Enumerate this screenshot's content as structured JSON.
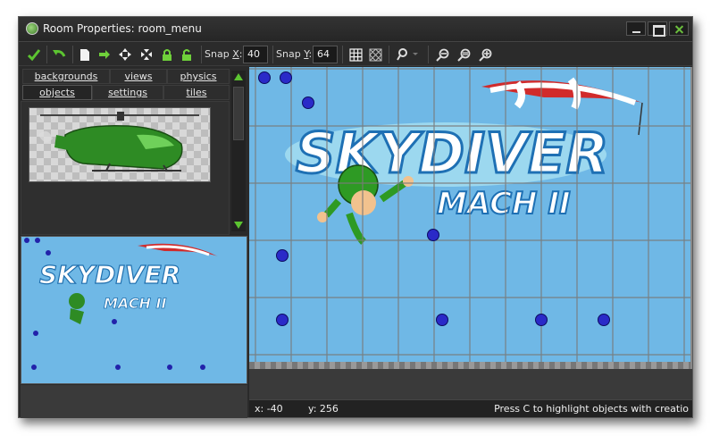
{
  "window": {
    "title": "Room Properties: room_menu",
    "accent": "#6bbf3d"
  },
  "toolbar": {
    "snap_x_label_pre": "Snap ",
    "snap_x_label_key": "X",
    "snap_x_label_post": ":",
    "snap_x_value": "40",
    "snap_y_label_pre": "Snap ",
    "snap_y_label_key": "Y",
    "snap_y_label_post": ":",
    "snap_y_value": "64",
    "icons": [
      "checkmark-icon",
      "undo-icon",
      "new-page-icon",
      "shift-right-icon",
      "expand-arrows-icon",
      "collapse-arrows-icon",
      "lock-icon",
      "unlock-icon",
      "grid-icon",
      "isometric-grid-icon",
      "magnify-dropdown-icon",
      "zoom-out-icon",
      "zoom-reset-icon",
      "zoom-in-icon"
    ]
  },
  "tabs": {
    "row1": [
      "backgrounds",
      "views",
      "physics"
    ],
    "row2": [
      "objects",
      "settings",
      "tiles"
    ],
    "active": "objects"
  },
  "room": {
    "logo_line1": "SKYDIVER",
    "logo_line2": "MACH II",
    "background_color": "#6fb8e6"
  },
  "status": {
    "x": "x: -40",
    "y": "y: 256",
    "hint": "Press C to highlight objects with creatio"
  }
}
